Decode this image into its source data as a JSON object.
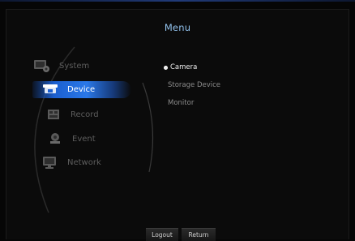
{
  "header": {
    "title": "Menu"
  },
  "sidebar": {
    "items": [
      {
        "label": "System",
        "icon": "system-icon"
      },
      {
        "label": "Device",
        "icon": "camera-icon",
        "selected": true
      },
      {
        "label": "Record",
        "icon": "record-icon"
      },
      {
        "label": "Event",
        "icon": "event-icon"
      },
      {
        "label": "Network",
        "icon": "network-icon"
      }
    ]
  },
  "submenu": {
    "items": [
      {
        "label": "Camera",
        "active": true
      },
      {
        "label": "Storage Device"
      },
      {
        "label": "Monitor"
      }
    ]
  },
  "footer": {
    "logout_label": "Logout",
    "return_label": "Return"
  },
  "colors": {
    "title": "#93c3ee",
    "selection": "#2a78e8",
    "inactive_text": "#5d5d5d"
  }
}
